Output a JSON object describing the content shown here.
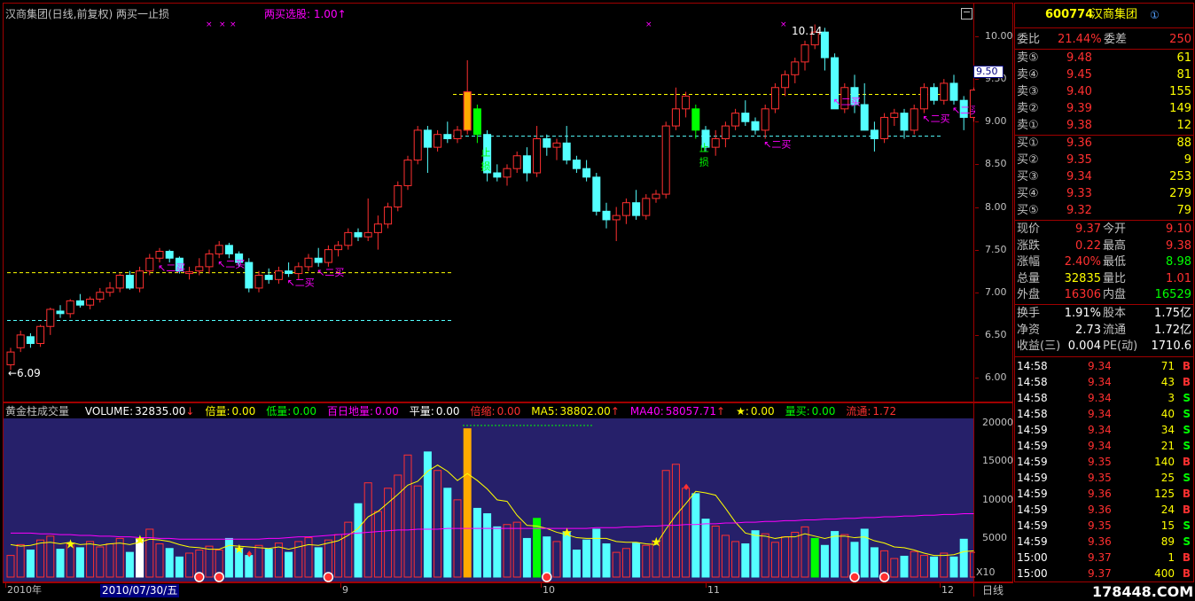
{
  "chart": {
    "title": "汉商集团(日线,前复权) 两买一止损",
    "indicator": "两买选股: 1.00↑",
    "y_ticks": [
      "10.00",
      "9.50",
      "9.00",
      "8.50",
      "8.00",
      "7.50",
      "7.00",
      "6.50",
      "6.00"
    ],
    "current_price_tag": "9.50",
    "high_label": "10.14",
    "low_label": "←6.09",
    "buy_label": "二买",
    "stop_label_1": "止",
    "stop_label_2": "损"
  },
  "volume": {
    "title": "黄金柱成交量",
    "stats": [
      {
        "label": "VOLUME:",
        "value": "32835.00",
        "arrow": "↓",
        "color": "#ffffff"
      },
      {
        "label": "倍量:",
        "value": "0.00",
        "arrow": "",
        "color": "#ffff00"
      },
      {
        "label": "低量:",
        "value": "0.00",
        "arrow": "",
        "color": "#00ff00"
      },
      {
        "label": "百日地量:",
        "value": "0.00",
        "arrow": "",
        "color": "#ff00ff"
      },
      {
        "label": "平量:",
        "value": "0.00",
        "arrow": "",
        "color": "#ffffff"
      },
      {
        "label": "倍缩:",
        "value": "0.00",
        "arrow": "",
        "color": "#ff3030"
      },
      {
        "label": "MA5:",
        "value": "38802.00",
        "arrow": "↑",
        "color": "#ffff00"
      },
      {
        "label": "MA40:",
        "value": "58057.71",
        "arrow": "↑",
        "color": "#ff00ff"
      },
      {
        "label": "★:",
        "value": "0.00",
        "arrow": "",
        "color": "#ffff00"
      },
      {
        "label": "量买:",
        "value": "0.00",
        "arrow": "",
        "color": "#00ff00"
      },
      {
        "label": "流通:",
        "value": "1.72",
        "arrow": "",
        "color": "#ff3030"
      }
    ],
    "y_ticks": [
      "20000",
      "15000",
      "10000",
      "5000"
    ],
    "unit": "X10"
  },
  "xaxis": {
    "labels": [
      "2010年",
      "9",
      "10",
      "11",
      "12"
    ],
    "cursor_date": "2010/07/30/五",
    "period": "日线"
  },
  "quote": {
    "code": "600774",
    "name": "汉商集团",
    "info_icon": "①",
    "weibi_label": "委比",
    "weibi_value": "21.44%",
    "weicha_label": "委差",
    "weicha_value": "250",
    "asks": [
      {
        "label": "卖⑤",
        "price": "9.48",
        "vol": "61"
      },
      {
        "label": "卖④",
        "price": "9.45",
        "vol": "81"
      },
      {
        "label": "卖③",
        "price": "9.40",
        "vol": "155"
      },
      {
        "label": "卖②",
        "price": "9.39",
        "vol": "149"
      },
      {
        "label": "卖①",
        "price": "9.38",
        "vol": "12"
      }
    ],
    "bids": [
      {
        "label": "买①",
        "price": "9.36",
        "vol": "88"
      },
      {
        "label": "买②",
        "price": "9.35",
        "vol": "9"
      },
      {
        "label": "买③",
        "price": "9.34",
        "vol": "253"
      },
      {
        "label": "买④",
        "price": "9.33",
        "vol": "279"
      },
      {
        "label": "买⑤",
        "price": "9.32",
        "vol": "79"
      }
    ],
    "stats": [
      {
        "l1": "现价",
        "v1": "9.37",
        "c1": "#ff3030",
        "l2": "今开",
        "v2": "9.10",
        "c2": "#ff3030"
      },
      {
        "l1": "涨跌",
        "v1": "0.22",
        "c1": "#ff3030",
        "l2": "最高",
        "v2": "9.38",
        "c2": "#ff3030"
      },
      {
        "l1": "涨幅",
        "v1": "2.40%",
        "c1": "#ff3030",
        "l2": "最低",
        "v2": "8.98",
        "c2": "#00ff00"
      },
      {
        "l1": "总量",
        "v1": "32835",
        "c1": "#ffff00",
        "l2": "量比",
        "v2": "1.01",
        "c2": "#ff3030"
      },
      {
        "l1": "外盘",
        "v1": "16306",
        "c1": "#ff3030",
        "l2": "内盘",
        "v2": "16529",
        "c2": "#00ff00"
      }
    ],
    "fundamentals": [
      {
        "l1": "换手",
        "v1": "1.91%",
        "l2": "股本",
        "v2": "1.75亿"
      },
      {
        "l1": "净资",
        "v1": "2.73",
        "l2": "流通",
        "v2": "1.72亿"
      },
      {
        "l1": "收益(三)",
        "v1": "0.004",
        "l2": "PE(动)",
        "v2": "1710.6"
      }
    ],
    "ticks": [
      {
        "time": "14:58",
        "price": "9.34",
        "vol": "71",
        "bs": "B"
      },
      {
        "time": "14:58",
        "price": "9.34",
        "vol": "43",
        "bs": "B"
      },
      {
        "time": "14:58",
        "price": "9.34",
        "vol": "3",
        "bs": "S"
      },
      {
        "time": "14:58",
        "price": "9.34",
        "vol": "40",
        "bs": "S"
      },
      {
        "time": "14:59",
        "price": "9.34",
        "vol": "34",
        "bs": "S"
      },
      {
        "time": "14:59",
        "price": "9.34",
        "vol": "21",
        "bs": "S"
      },
      {
        "time": "14:59",
        "price": "9.35",
        "vol": "140",
        "bs": "B"
      },
      {
        "time": "14:59",
        "price": "9.35",
        "vol": "25",
        "bs": "S"
      },
      {
        "time": "14:59",
        "price": "9.36",
        "vol": "125",
        "bs": "B"
      },
      {
        "time": "14:59",
        "price": "9.36",
        "vol": "24",
        "bs": "B"
      },
      {
        "time": "14:59",
        "price": "9.35",
        "vol": "15",
        "bs": "S"
      },
      {
        "time": "14:59",
        "price": "9.36",
        "vol": "89",
        "bs": "S"
      },
      {
        "time": "15:00",
        "price": "9.37",
        "vol": "1",
        "bs": "B"
      },
      {
        "time": "15:00",
        "price": "9.37",
        "vol": "400",
        "bs": "B"
      }
    ]
  },
  "watermark": "178448.COM",
  "colors": {
    "up": "#ff3030",
    "down": "#54ffff",
    "grid": "#a00000",
    "vol_bg": "#26206a",
    "yellow": "#ffff00",
    "magenta": "#ff00ff",
    "cyan": "#54ffff",
    "green": "#00ff00"
  },
  "chart_data": {
    "type": "candlestick",
    "series_name": "汉商集团 日线",
    "ylim": [
      5.85,
      10.25
    ],
    "volume_ylim": [
      0,
      21000
    ],
    "ohlc": [
      [
        6.15,
        6.35,
        6.09,
        6.3
      ],
      [
        6.35,
        6.55,
        6.3,
        6.5
      ],
      [
        6.48,
        6.52,
        6.35,
        6.4
      ],
      [
        6.4,
        6.62,
        6.36,
        6.6
      ],
      [
        6.6,
        6.82,
        6.5,
        6.8
      ],
      [
        6.78,
        6.85,
        6.7,
        6.75
      ],
      [
        6.75,
        6.92,
        6.7,
        6.9
      ],
      [
        6.9,
        6.98,
        6.82,
        6.85
      ],
      [
        6.85,
        6.95,
        6.8,
        6.92
      ],
      [
        6.92,
        7.05,
        6.88,
        7.0
      ],
      [
        7.0,
        7.12,
        6.95,
        7.05
      ],
      [
        7.05,
        7.22,
        7.0,
        7.2
      ],
      [
        7.2,
        7.25,
        7.03,
        7.05
      ],
      [
        7.05,
        7.3,
        7.0,
        7.25
      ],
      [
        7.25,
        7.45,
        7.2,
        7.4
      ],
      [
        7.4,
        7.52,
        7.35,
        7.48
      ],
      [
        7.48,
        7.5,
        7.35,
        7.4
      ],
      [
        7.4,
        7.42,
        7.22,
        7.25
      ],
      [
        7.22,
        7.3,
        7.15,
        7.24
      ],
      [
        7.25,
        7.4,
        7.2,
        7.3
      ],
      [
        7.3,
        7.5,
        7.22,
        7.45
      ],
      [
        7.45,
        7.6,
        7.4,
        7.55
      ],
      [
        7.55,
        7.58,
        7.4,
        7.45
      ],
      [
        7.45,
        7.48,
        7.3,
        7.35
      ],
      [
        7.35,
        7.4,
        7.0,
        7.05
      ],
      [
        7.05,
        7.25,
        7.0,
        7.2
      ],
      [
        7.2,
        7.28,
        7.1,
        7.15
      ],
      [
        7.15,
        7.3,
        7.1,
        7.25
      ],
      [
        7.25,
        7.35,
        7.18,
        7.22
      ],
      [
        7.22,
        7.35,
        7.15,
        7.3
      ],
      [
        7.3,
        7.45,
        7.25,
        7.4
      ],
      [
        7.4,
        7.52,
        7.3,
        7.35
      ],
      [
        7.35,
        7.55,
        7.3,
        7.5
      ],
      [
        7.5,
        7.6,
        7.42,
        7.55
      ],
      [
        7.55,
        7.75,
        7.5,
        7.7
      ],
      [
        7.7,
        7.75,
        7.6,
        7.65
      ],
      [
        7.65,
        8.1,
        7.6,
        7.7
      ],
      [
        7.7,
        7.9,
        7.5,
        7.8
      ],
      [
        7.8,
        8.05,
        7.75,
        8.0
      ],
      [
        8.0,
        8.3,
        7.95,
        8.25
      ],
      [
        8.25,
        8.6,
        8.2,
        8.55
      ],
      [
        8.55,
        8.95,
        8.5,
        8.9
      ],
      [
        8.9,
        8.95,
        8.4,
        8.7
      ],
      [
        8.7,
        8.9,
        8.65,
        8.85
      ],
      [
        8.85,
        9.0,
        8.75,
        8.8
      ],
      [
        8.8,
        8.95,
        8.75,
        8.9
      ],
      [
        8.9,
        9.72,
        8.85,
        9.35
      ],
      [
        9.15,
        9.2,
        8.75,
        8.85
      ],
      [
        8.85,
        8.9,
        8.3,
        8.4
      ],
      [
        8.4,
        8.5,
        8.3,
        8.35
      ],
      [
        8.35,
        8.5,
        8.25,
        8.45
      ],
      [
        8.45,
        8.65,
        8.4,
        8.6
      ],
      [
        8.6,
        8.7,
        8.3,
        8.4
      ],
      [
        8.4,
        8.95,
        8.35,
        8.8
      ],
      [
        8.8,
        8.85,
        8.6,
        8.7
      ],
      [
        8.7,
        8.8,
        8.55,
        8.75
      ],
      [
        8.75,
        8.95,
        8.5,
        8.55
      ],
      [
        8.55,
        8.6,
        8.4,
        8.45
      ],
      [
        8.45,
        8.55,
        8.3,
        8.35
      ],
      [
        8.35,
        8.4,
        7.9,
        7.95
      ],
      [
        7.95,
        8.05,
        7.75,
        7.85
      ],
      [
        7.85,
        8.0,
        7.6,
        7.9
      ],
      [
        7.9,
        8.1,
        7.8,
        8.05
      ],
      [
        8.05,
        8.2,
        7.85,
        7.9
      ],
      [
        7.9,
        8.15,
        7.85,
        8.1
      ],
      [
        8.1,
        8.2,
        8.05,
        8.15
      ],
      [
        8.15,
        9.0,
        8.1,
        8.95
      ],
      [
        8.95,
        9.4,
        8.9,
        9.15
      ],
      [
        9.15,
        9.35,
        9.05,
        9.3
      ],
      [
        9.15,
        9.2,
        8.8,
        8.9
      ],
      [
        8.9,
        8.95,
        8.65,
        8.7
      ],
      [
        8.7,
        8.9,
        8.6,
        8.8
      ],
      [
        8.8,
        9.0,
        8.7,
        8.95
      ],
      [
        8.95,
        9.15,
        8.9,
        9.1
      ],
      [
        9.1,
        9.25,
        8.95,
        9.0
      ],
      [
        9.0,
        9.05,
        8.85,
        8.9
      ],
      [
        8.9,
        9.2,
        8.8,
        9.15
      ],
      [
        9.15,
        9.45,
        9.1,
        9.4
      ],
      [
        9.4,
        9.6,
        9.3,
        9.55
      ],
      [
        9.55,
        9.75,
        9.45,
        9.7
      ],
      [
        9.7,
        9.95,
        9.6,
        9.9
      ],
      [
        9.9,
        10.14,
        9.85,
        10.05
      ],
      [
        10.05,
        10.1,
        9.6,
        9.75
      ],
      [
        9.75,
        9.8,
        9.3,
        9.15
      ],
      [
        9.15,
        9.45,
        9.1,
        9.4
      ],
      [
        9.4,
        9.55,
        9.1,
        9.2
      ],
      [
        9.2,
        9.45,
        8.9,
        8.9
      ],
      [
        8.9,
        9.0,
        8.65,
        8.8
      ],
      [
        8.8,
        9.1,
        8.75,
        9.05
      ],
      [
        9.05,
        9.15,
        8.95,
        9.1
      ],
      [
        9.1,
        9.15,
        8.8,
        8.9
      ],
      [
        8.9,
        9.2,
        8.85,
        9.15
      ],
      [
        9.15,
        9.45,
        9.1,
        9.4
      ],
      [
        9.4,
        9.45,
        9.2,
        9.25
      ],
      [
        9.25,
        9.5,
        9.2,
        9.45
      ],
      [
        9.45,
        9.55,
        9.2,
        9.25
      ],
      [
        9.25,
        9.3,
        8.9,
        9.05
      ],
      [
        9.05,
        9.4,
        9.0,
        9.37
      ]
    ],
    "volume": [
      2800,
      4200,
      3500,
      4800,
      5300,
      3600,
      4300,
      3800,
      4600,
      3900,
      4300,
      5000,
      3200,
      4900,
      6200,
      4300,
      3700,
      2600,
      3100,
      3500,
      4000,
      3500,
      5000,
      3700,
      2800,
      4100,
      3600,
      4400,
      3200,
      4600,
      5100,
      3800,
      4800,
      5500,
      7100,
      9500,
      12200,
      8500,
      11500,
      13200,
      15800,
      11800,
      16200,
      13800,
      11500,
      10000,
      19200,
      8900,
      8200,
      6500,
      6800,
      7100,
      5000,
      7600,
      5200,
      4600,
      5800,
      3500,
      4800,
      6200,
      4300,
      3200,
      3700,
      4400,
      4100,
      4600,
      13800,
      14600,
      11500,
      10800,
      7500,
      6600,
      5400,
      4600,
      4300,
      6000,
      5600,
      4500,
      5200,
      5800,
      6500,
      5000,
      4100,
      5900,
      5500,
      4500,
      6200,
      3800,
      3400,
      2400,
      2700,
      3300,
      2800,
      2600,
      3100,
      2600,
      4900,
      3200
    ],
    "ma5_volume": [
      4200,
      4000,
      4100,
      4400,
      4500,
      4300,
      4500,
      4200,
      4300,
      4100,
      4300,
      4400,
      4200,
      4500,
      4900,
      4800,
      4600,
      4200,
      3900,
      3800,
      3600,
      3600,
      4100,
      4000,
      3900,
      3800,
      3700,
      3900,
      3600,
      3900,
      4200,
      4100,
      4400,
      4700,
      5400,
      6300,
      7800,
      8500,
      9600,
      10700,
      11900,
      12400,
      13700,
      14500,
      13700,
      12500,
      13400,
      12500,
      11400,
      10000,
      9800,
      8000,
      6700,
      6600,
      6300,
      5800,
      5500,
      5100,
      5000,
      5000,
      5000,
      4600,
      4500,
      4500,
      4300,
      4200,
      6200,
      8000,
      9500,
      11100,
      10900,
      10600,
      8900,
      7100,
      5700,
      5400,
      5300,
      5000,
      5200,
      5200,
      5600,
      5300,
      5000,
      5300,
      5300,
      5100,
      5200,
      4700,
      4400,
      3900,
      3800,
      3500,
      3100,
      2800,
      2800,
      2900,
      3300,
      3400
    ],
    "ma40_volume": [
      5700,
      5700,
      5700,
      5600,
      5600,
      5500,
      5500,
      5400,
      5400,
      5300,
      5300,
      5200,
      5200,
      5100,
      5100,
      5000,
      5000,
      4900,
      4900,
      4900,
      4900,
      4900,
      4900,
      4900,
      4900,
      4900,
      5000,
      5000,
      5100,
      5200,
      5200,
      5300,
      5400,
      5500,
      5600,
      5700,
      5800,
      5900,
      6000,
      6100,
      6100,
      6200,
      6200,
      6200,
      6300,
      6300,
      6300,
      6300,
      6300,
      6300,
      6300,
      6300,
      6300,
      6300,
      6300,
      6300,
      6300,
      6300,
      6300,
      6400,
      6400,
      6400,
      6500,
      6500,
      6600,
      6600,
      6700,
      6700,
      6800,
      6800,
      6900,
      6900,
      7000,
      7000,
      7100,
      7100,
      7200,
      7200,
      7300,
      7300,
      7400,
      7400,
      7500,
      7500,
      7600,
      7600,
      7700,
      7700,
      7800,
      7800,
      7900,
      7900,
      8000,
      8000,
      8100,
      8100,
      8200,
      8200
    ]
  }
}
